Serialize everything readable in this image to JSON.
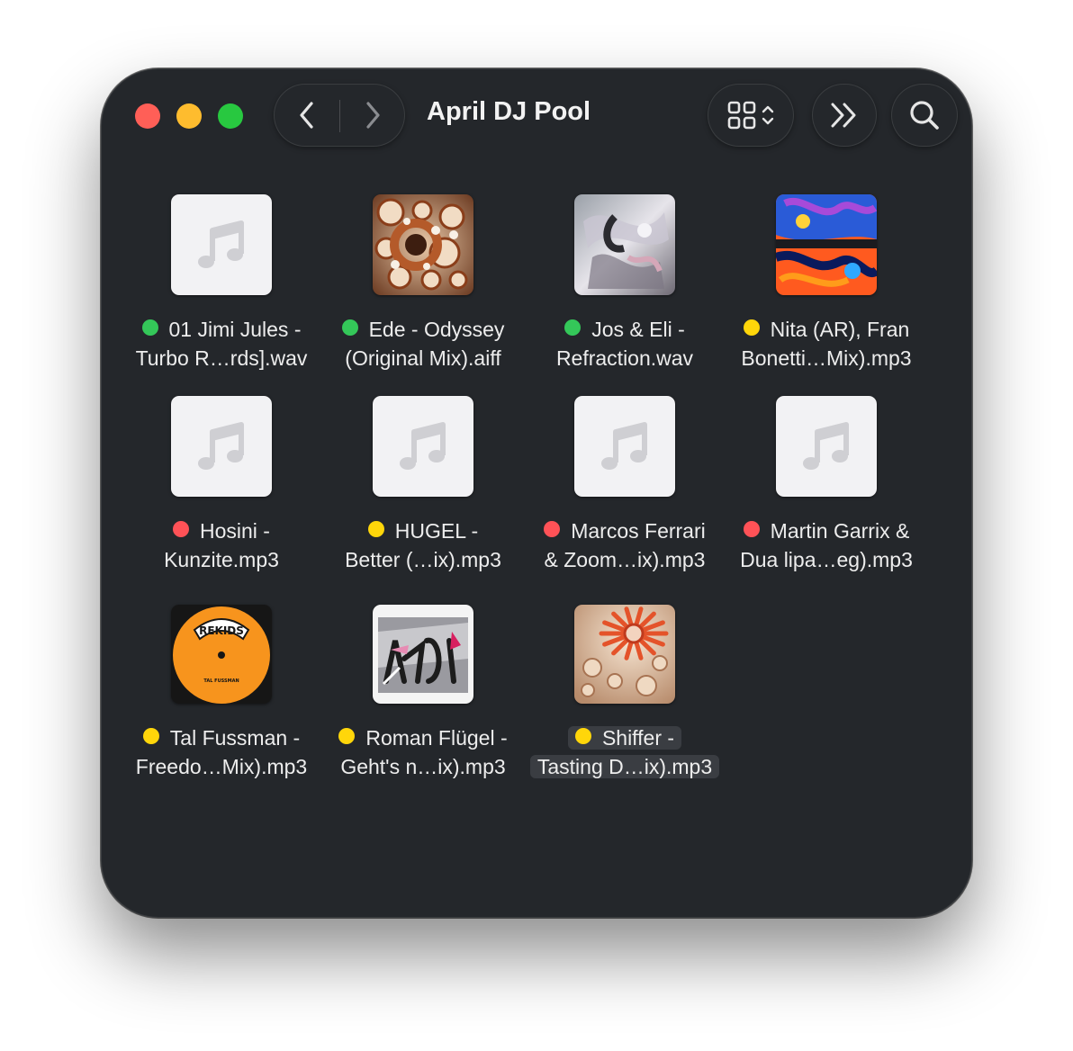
{
  "window": {
    "title": "April DJ Pool",
    "traffic_lights": {
      "close": "#ff5f57",
      "minimize": "#febc2e",
      "maximize": "#28c840"
    }
  },
  "toolbar": {
    "back_icon": "chevron-left-icon",
    "forward_icon": "chevron-right-icon",
    "view_icon": "grid-view-icon",
    "more_icon": "double-chevron-right-icon",
    "search_icon": "search-icon"
  },
  "tag_colors": {
    "green": "#34c759",
    "yellow": "#ffd60a",
    "red": "#ff5257"
  },
  "files": [
    {
      "line1": "01 Jimi Jules -",
      "line2": "Turbo R…rds].wav",
      "tag": "green",
      "art": "placeholder"
    },
    {
      "line1": "Ede - Odyssey",
      "line2": "(Original Mix).aiff",
      "tag": "green",
      "art": "coral"
    },
    {
      "line1": "Jos & Eli -",
      "line2": "Refraction.wav",
      "tag": "green",
      "art": "chrome"
    },
    {
      "line1": "Nita (AR), Fran",
      "line2": "Bonetti…Mix).mp3",
      "tag": "yellow",
      "art": "splash"
    },
    {
      "line1": "Hosini -",
      "line2": "Kunzite.mp3",
      "tag": "red",
      "art": "placeholder"
    },
    {
      "line1": "HUGEL -",
      "line2": "Better (…ix).mp3",
      "tag": "yellow",
      "art": "placeholder"
    },
    {
      "line1": "Marcos Ferrari",
      "line2": "& Zoom…ix).mp3",
      "tag": "red",
      "art": "placeholder"
    },
    {
      "line1": "Martin Garrix &",
      "line2": "Dua lipa…eg).mp3",
      "tag": "red",
      "art": "placeholder"
    },
    {
      "line1": "Tal Fussman -",
      "line2": "Freedo…Mix).mp3",
      "tag": "yellow",
      "art": "rekids",
      "art_text": "REKIDS",
      "art_subtext": "TAL FUSSMAN"
    },
    {
      "line1": "Roman Flügel -",
      "line2": "Geht's n…ix).mp3",
      "tag": "yellow",
      "art": "graffiti"
    },
    {
      "line1": "Shiffer -",
      "line2": "Tasting D…ix).mp3",
      "tag": "yellow",
      "art": "shell",
      "selected": true
    }
  ]
}
